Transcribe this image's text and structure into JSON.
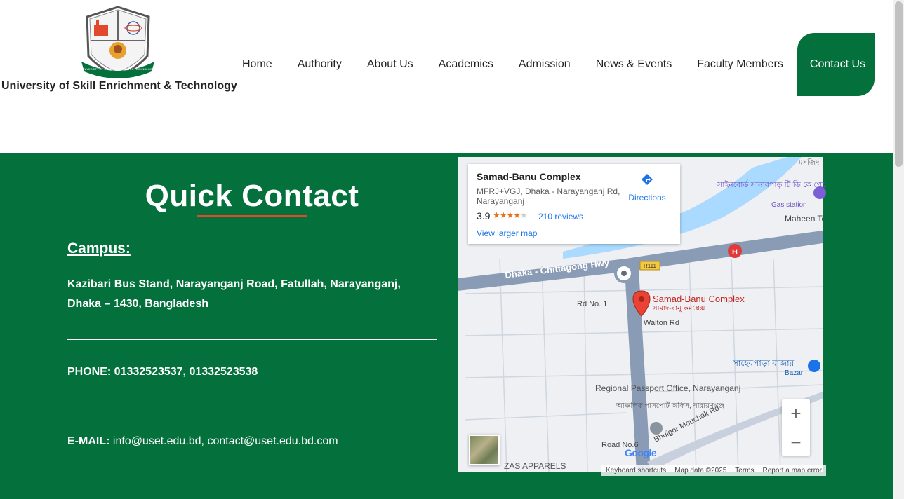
{
  "header": {
    "university_name": "University of Skill Enrichment & Technology",
    "logo_ribbon_text": "UNIVERSITY OF SKILL ENRICHMENT & TECHNOLOGY",
    "nav": [
      {
        "label": "Home"
      },
      {
        "label": "Authority"
      },
      {
        "label": "About Us"
      },
      {
        "label": "Academics"
      },
      {
        "label": "Admission"
      },
      {
        "label": "News & Events"
      },
      {
        "label": "Faculty Members"
      },
      {
        "label": "Contact Us",
        "active": true
      }
    ]
  },
  "contact": {
    "title": "Quick Contact",
    "campus_label": "Campus:",
    "campus_address": "Kazibari Bus Stand, Narayanganj Road, Fatullah, Narayanganj, Dhaka – 1430, Bangladesh",
    "phone": "PHONE: 01332523537, 01332523538",
    "email_label": "E-MAIL:",
    "email_value": "info@uset.edu.bd, contact@uset.edu.bd.com"
  },
  "map": {
    "place_name": "Samad-Banu Complex",
    "place_address": "MFRJ+VGJ, Dhaka - Narayanganj Rd, Narayanganj",
    "rating": "3.9",
    "rating_fraction": 0.78,
    "reviews": "210 reviews",
    "view_larger": "View larger map",
    "directions": "Directions",
    "zoom_in": "+",
    "zoom_out": "−",
    "google": "Google",
    "footer": {
      "shortcuts": "Keyboard shortcuts",
      "map_data": "Map data ©2025",
      "terms": "Terms",
      "report": "Report a map error"
    },
    "labels": {
      "highway": "Dhaka - Chittagong Hwy",
      "route": "R111",
      "road_no1": "Rd No. 1",
      "walton": "Walton Rd",
      "marker_en": "Samad-Banu Complex",
      "marker_bn": "সামাদ-বানু কমপ্লেক্স",
      "passport_en": "Regional Passport Office, Narayanganj",
      "passport_bn": "আঞ্চলিক পাসপোর্ট অফিস, নারায়ণগঞ্জ",
      "road_no6": "Road No.6",
      "bhuigor": "Bhuigor Mouchak Rd",
      "zas": "ZAS APPARELS",
      "gas_bn": "সাইনবোর্ড সানারপাড় টি ডি কে পেট্রোল পাম্প",
      "gas": "Gas station",
      "maheen": "Maheen Tex Li",
      "bazar_bn": "সাহেবপাড়া বাজার",
      "bazar": "Bazar",
      "masjid": "মসজিদ"
    }
  },
  "colors": {
    "brand_green": "#04703c",
    "accent_red": "#e0492b",
    "link_blue": "#1a73e8"
  }
}
